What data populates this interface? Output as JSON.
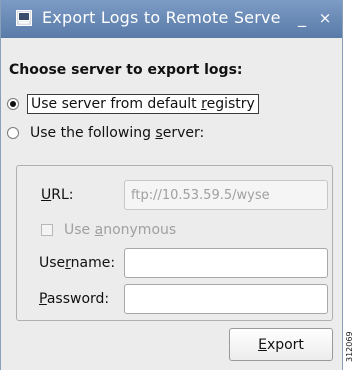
{
  "window": {
    "title": "Export Logs to Remote Serve",
    "minimize_glyph": "_",
    "close_glyph": "×",
    "icon": "export-app-icon"
  },
  "dialog": {
    "heading": "Choose server to export logs:",
    "radio_default": {
      "label_pre": "Use server from default ",
      "label_accel": "r",
      "label_post": "egistry",
      "checked": true
    },
    "radio_following": {
      "label_pre": "Use the following ",
      "label_accel": "s",
      "label_post": "erver:",
      "checked": false
    },
    "url": {
      "label_accel": "U",
      "label_post": "RL:",
      "placeholder": "ftp://10.53.59.5/wyse",
      "value": ""
    },
    "anonymous": {
      "label_pre": "Use ",
      "label_accel": "a",
      "label_post": "nonymous",
      "checked": false
    },
    "username": {
      "label_pre": "Use",
      "label_accel": "r",
      "label_post": "name:",
      "value": ""
    },
    "password": {
      "label_accel": "P",
      "label_post": "assword:",
      "value": ""
    },
    "export_button": {
      "label_accel": "E",
      "label_post": "xport"
    }
  },
  "watermark": "312069"
}
